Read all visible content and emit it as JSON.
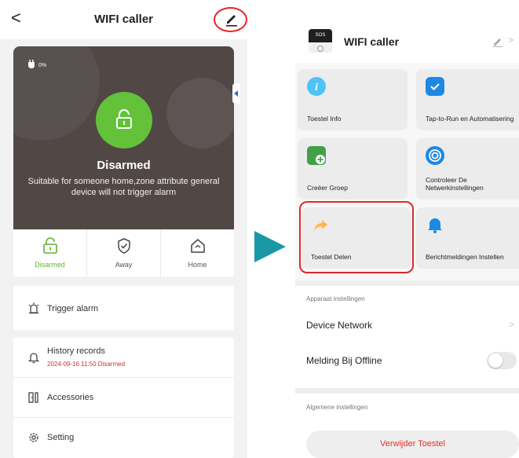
{
  "left": {
    "title": "WIFI caller",
    "back_glyph": "<",
    "battery_text": "0%",
    "state_title": "Disarmed",
    "state_desc": "Suitable for someone home,zone attribute general device will not trigger alarm",
    "modes": [
      {
        "label": "Disarmed",
        "icon": "unlock-icon",
        "active": true
      },
      {
        "label": "Away",
        "icon": "shield-check-icon",
        "active": false
      },
      {
        "label": "Home",
        "icon": "home-icon",
        "active": false
      }
    ],
    "trigger_alarm": "Trigger alarm",
    "history": {
      "label": "History records",
      "latest": "2024-09-16 11:50 Disarmed"
    },
    "accessories": "Accessories",
    "setting": "Setting",
    "colors": {
      "accent_green": "#63c239",
      "hero_bg": "#514846",
      "highlight_red": "#e22222"
    }
  },
  "right": {
    "title": "WIFI caller",
    "device_image_text": "SOS",
    "tiles": [
      {
        "label": "Toestel Info",
        "icon": "info-icon",
        "color": "#4fc3f7"
      },
      {
        "label": "Tap-to-Run en Automatisering",
        "icon": "check-badge-icon",
        "color": "#1e88e5"
      },
      {
        "label": "Creëer Groep",
        "icon": "add-group-icon",
        "color": "#43a047"
      },
      {
        "label": "Controleer De Netwerkinstellingen",
        "icon": "network-icon",
        "color": "#1e88e5"
      },
      {
        "label": "Toestel Delen",
        "icon": "share-arrow-icon",
        "color": "#ffb74d"
      },
      {
        "label": "Berichtmeldingen Instellen",
        "icon": "bell-icon",
        "color": "#1e88e5"
      }
    ],
    "section_device": "Apparaat instellingen",
    "device_network": "Device Network",
    "offline_label": "Melding Bij Offline",
    "offline_on": false,
    "section_general": "Algemene instellingen",
    "remove_button": "Verwijder Toestel",
    "colors": {
      "danger": "#e0332f",
      "arrow_teal": "#1a98a6"
    }
  }
}
